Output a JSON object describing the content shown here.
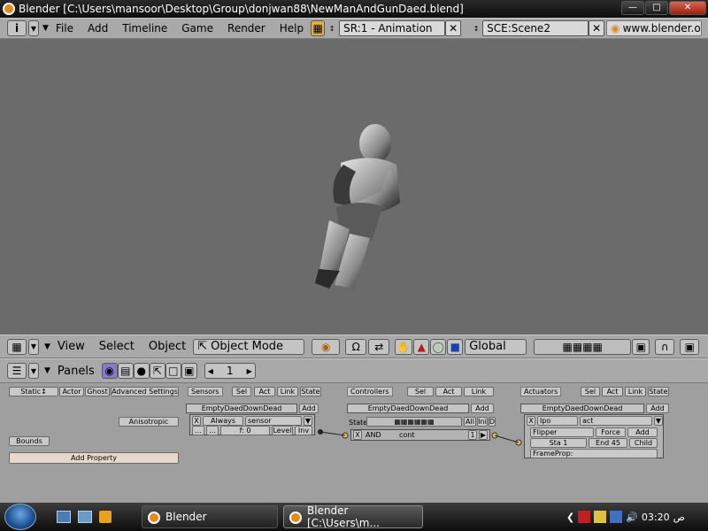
{
  "window": {
    "title": "Blender [C:\\Users\\mansoor\\Desktop\\Group\\donjwan88\\NewManAndGunDaed.blend]"
  },
  "top_header": {
    "menus": [
      "File",
      "Add",
      "Timeline",
      "Game",
      "Render",
      "Help"
    ],
    "screen": "SR:1 - Animation",
    "scene": "SCE:Scene2",
    "url": "www.blender.org"
  },
  "view_header": {
    "menus": [
      "View",
      "Select",
      "Object"
    ],
    "mode": "Object Mode",
    "orientation": "Global"
  },
  "buttons_header": {
    "label": "Panels",
    "frame": "1"
  },
  "physics": {
    "type": "Static",
    "buttons": [
      "Actor",
      "Ghost",
      "Advanced Settings"
    ],
    "anisotropic": "Anisotropic",
    "bounds": "Bounds",
    "add_property": "Add Property"
  },
  "sensors": {
    "title": "Sensors",
    "filters": [
      "Sel",
      "Act",
      "Link",
      "State"
    ],
    "object": "EmptyDaedDownDead",
    "add": "Add",
    "type": "Always",
    "name": "sensor",
    "freq": "f: 0",
    "level": "Level",
    "inv": "Inv"
  },
  "controllers": {
    "title": "Controllers",
    "filters": [
      "Sel",
      "Act",
      "Link"
    ],
    "object": "EmptyDaedDownDead",
    "add": "Add",
    "state_label": "State",
    "state_buttons": [
      "All",
      "Ini",
      "D"
    ],
    "type": "AND",
    "name": "cont",
    "priority": "1"
  },
  "actuators": {
    "title": "Actuators",
    "filters": [
      "Sel",
      "Act",
      "Link",
      "State"
    ],
    "object": "EmptyDaedDownDead",
    "add": "Add",
    "type": "Ipo",
    "name": "act",
    "mode": "Flipper",
    "force": "Force",
    "add2": "Add",
    "sta": "Sta 1",
    "end": "End 45",
    "child": "Child",
    "frameprop": "FrameProp:"
  },
  "taskbar": {
    "tasks": [
      "Blender",
      "Blender [C:\\Users\\m..."
    ],
    "time": "03:20",
    "ampm": "ص"
  },
  "colors": {
    "viewport": "#6b6b6b",
    "header": "#a9a9a9",
    "buttons_bg": "#9f9f9f"
  }
}
